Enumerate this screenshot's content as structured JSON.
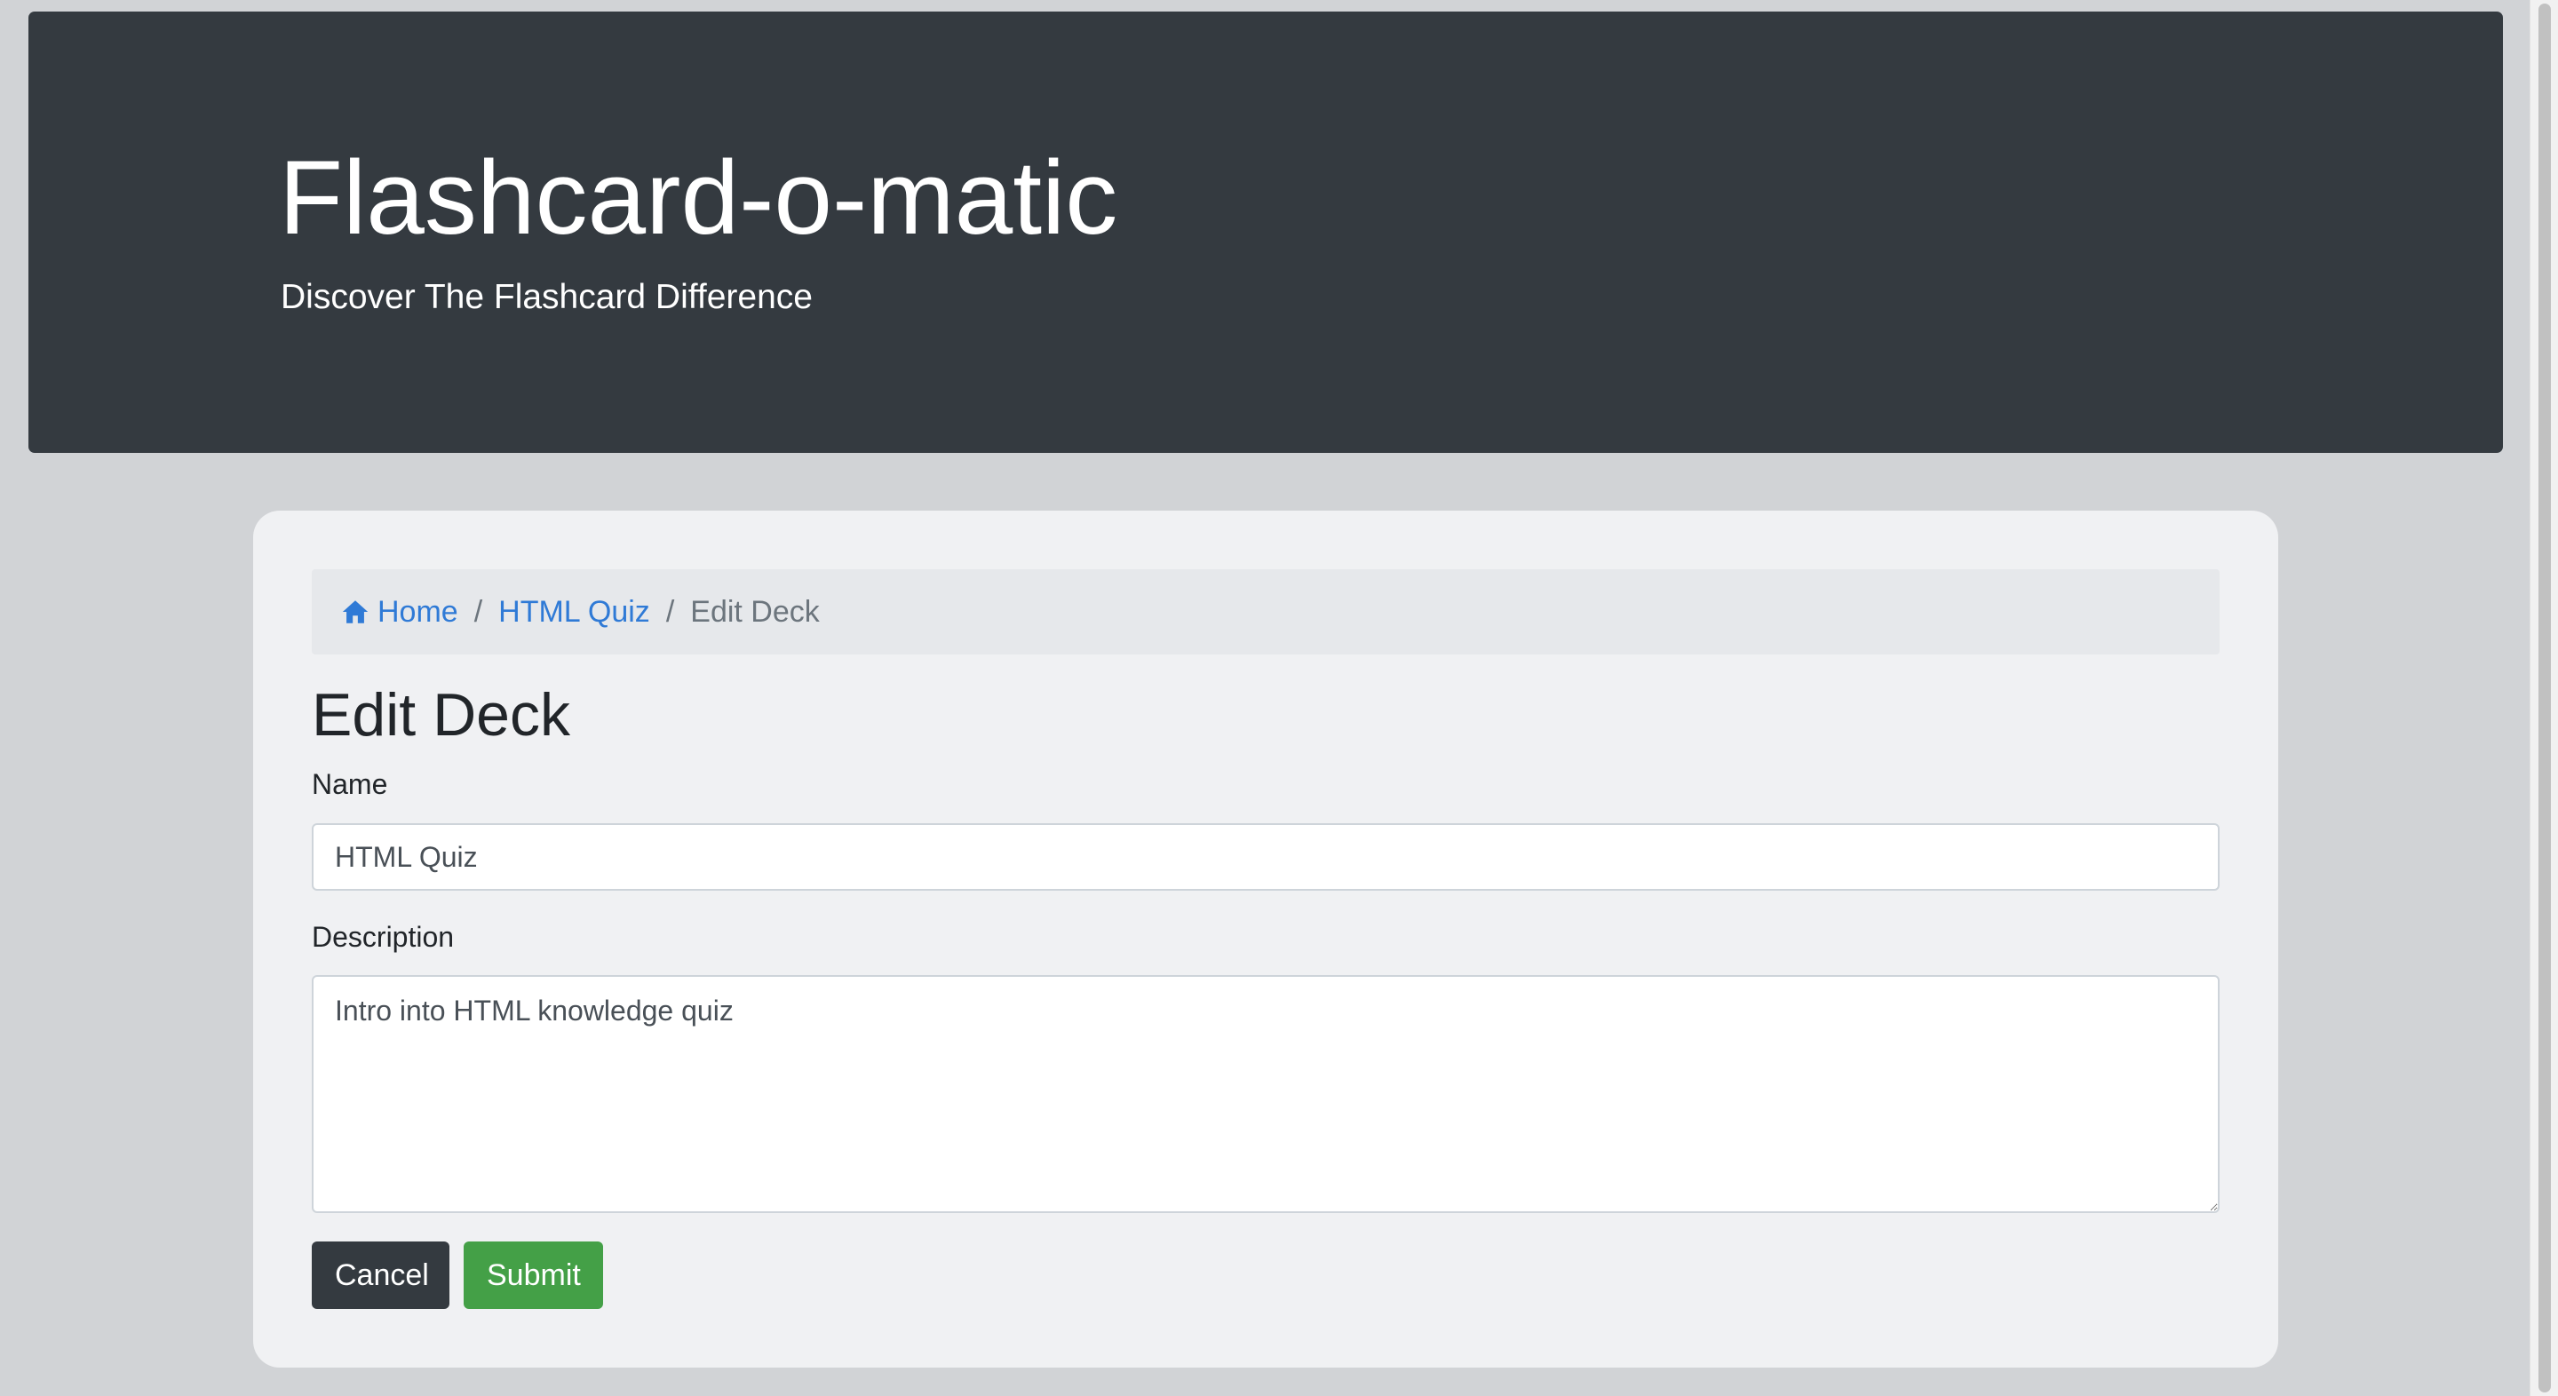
{
  "header": {
    "title": "Flashcard-o-matic",
    "subtitle": "Discover The Flashcard Difference",
    "background_color": "#343a40"
  },
  "breadcrumb": {
    "items": [
      {
        "label": "Home",
        "icon": "home-icon"
      },
      {
        "label": "HTML Quiz"
      }
    ],
    "separator": "/",
    "active": "Edit Deck",
    "link_color": "#2f7ad6"
  },
  "form": {
    "heading": "Edit Deck",
    "name_label": "Name",
    "name_value": "HTML Quiz",
    "description_label": "Description",
    "description_value": "Intro into HTML knowledge quiz",
    "cancel_label": "Cancel",
    "submit_label": "Submit",
    "cancel_color": "#343a40",
    "submit_color": "#44a047"
  }
}
